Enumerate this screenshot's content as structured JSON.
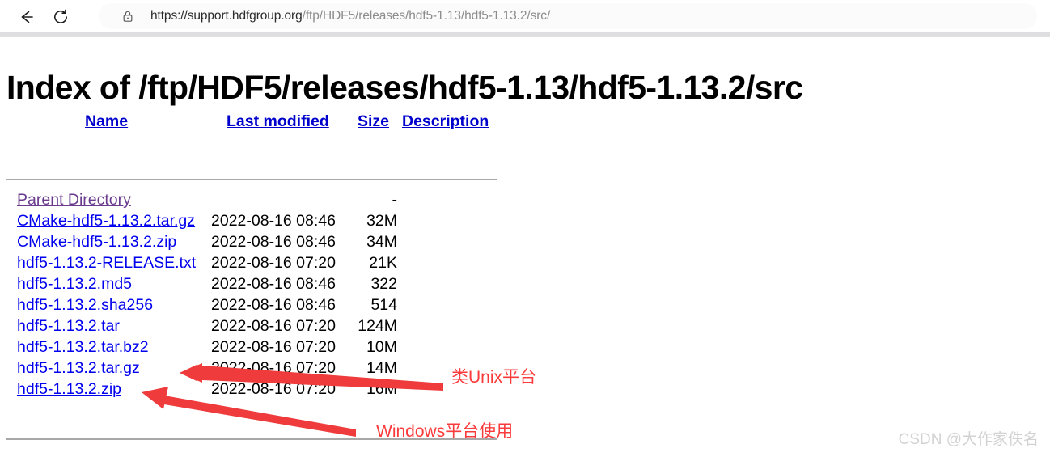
{
  "browser": {
    "back_icon": "back-arrow-icon",
    "reload_icon": "reload-icon",
    "lock_icon": "lock-icon",
    "url_scheme_host": "https://support.hdfgroup.org",
    "url_path": "/ftp/HDF5/releases/hdf5-1.13/hdf5-1.13.2/src/",
    "url_full": "https://support.hdfgroup.org/ftp/HDF5/releases/hdf5-1.13/hdf5-1.13.2/src/"
  },
  "page": {
    "title": "Index of /ftp/HDF5/releases/hdf5-1.13/hdf5-1.13.2/src",
    "columns": {
      "name": "Name",
      "last_modified": "Last modified",
      "size": "Size",
      "description": "Description"
    },
    "rows": [
      {
        "name": "Parent Directory",
        "modified": "",
        "size": "-",
        "visited": true
      },
      {
        "name": "CMake-hdf5-1.13.2.tar.gz",
        "modified": "2022-08-16 08:46",
        "size": "32M",
        "visited": false
      },
      {
        "name": "CMake-hdf5-1.13.2.zip",
        "modified": "2022-08-16 08:46",
        "size": "34M",
        "visited": false
      },
      {
        "name": "hdf5-1.13.2-RELEASE.txt",
        "modified": "2022-08-16 07:20",
        "size": "21K",
        "visited": false
      },
      {
        "name": "hdf5-1.13.2.md5",
        "modified": "2022-08-16 08:46",
        "size": "322",
        "visited": false
      },
      {
        "name": "hdf5-1.13.2.sha256",
        "modified": "2022-08-16 08:46",
        "size": "514",
        "visited": false
      },
      {
        "name": "hdf5-1.13.2.tar",
        "modified": "2022-08-16 07:20",
        "size": "124M",
        "visited": false
      },
      {
        "name": "hdf5-1.13.2.tar.bz2",
        "modified": "2022-08-16 07:20",
        "size": "10M",
        "visited": false
      },
      {
        "name": "hdf5-1.13.2.tar.gz",
        "modified": "2022-08-16 07:20",
        "size": "14M",
        "visited": false
      },
      {
        "name": "hdf5-1.13.2.zip",
        "modified": "2022-08-16 07:20",
        "size": "16M",
        "visited": false
      }
    ]
  },
  "annotations": {
    "unix_label": "类Unix平台",
    "windows_label": "Windows平台使用",
    "arrow_color": "#ef3b3b"
  },
  "watermark": "CSDN @大作家佚名",
  "colors": {
    "link": "#0000ee",
    "visited_link": "#6a3b8f",
    "header_link": "#0000cc",
    "annotation_red": "#fb3b3b",
    "rule": "#a8a8a8"
  }
}
